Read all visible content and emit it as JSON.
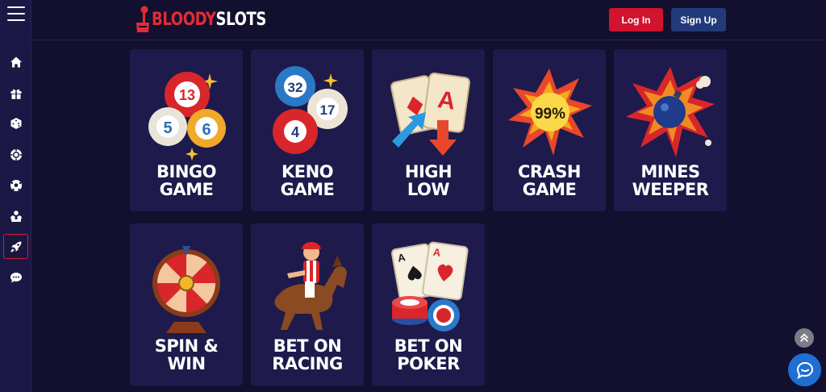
{
  "brand": {
    "part1": "BLOODY",
    "part2": "SLOTS",
    "red": "#e52a36"
  },
  "header": {
    "login_label": "Log In",
    "signup_label": "Sign Up"
  },
  "sidebar": {
    "items": [
      {
        "icon": "home-icon"
      },
      {
        "icon": "gift-icon"
      },
      {
        "icon": "dice-icon"
      },
      {
        "icon": "casino-chip-icon"
      },
      {
        "icon": "soccer-ball-icon"
      },
      {
        "icon": "cards-icon"
      },
      {
        "icon": "rocket-icon",
        "active": true
      },
      {
        "icon": "chat-icon"
      }
    ]
  },
  "games": [
    {
      "line1": "BINGO",
      "line2": "GAME"
    },
    {
      "line1": "KENO",
      "line2": "GAME"
    },
    {
      "line1": "HIGH",
      "line2": "LOW"
    },
    {
      "line1": "CRASH",
      "line2": "GAME",
      "badge": "99%"
    },
    {
      "line1": "MINES",
      "line2": "WEEPER"
    },
    {
      "line1": "SPIN &",
      "line2": "WIN"
    },
    {
      "line1": "BET ON",
      "line2": "RACING"
    },
    {
      "line1": "BET ON",
      "line2": "POKER"
    }
  ],
  "bingo_balls": [
    "13",
    "5",
    "6"
  ],
  "keno_balls": [
    "32",
    "17",
    "4"
  ],
  "high_low_card": "A",
  "poker_cards": [
    "A",
    "A"
  ],
  "colors": {
    "accent_red": "#d1132e",
    "signup_blue": "#233a7a",
    "card_bg": "#1e1a4c",
    "page_bg": "#12102e"
  }
}
